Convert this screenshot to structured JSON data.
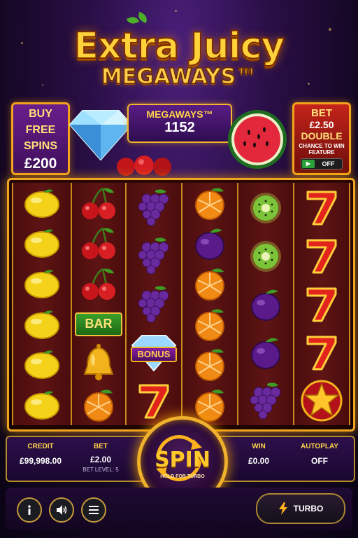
{
  "logo": {
    "title": "Extra Juicy",
    "subtitle": "MEGAWAYS™"
  },
  "buy_free_spins": {
    "line1": "BUY",
    "line2": "FREE",
    "line3": "SPINS",
    "price": "£200"
  },
  "megaways": {
    "label": "MEGAWAYS™",
    "count": "1152"
  },
  "bet_double": {
    "line1": "BET",
    "line2": "£2.50",
    "line3": "DOUBLE",
    "line4": "CHANCE TO WIN FEATURE",
    "toggle_state": "OFF"
  },
  "reels": [
    [
      "lemon",
      "lemon",
      "lemon",
      "lemon",
      "lemon",
      "lemon"
    ],
    [
      "cherries",
      "cherries",
      "cherries",
      "bar",
      "bell",
      "orange"
    ],
    [
      "grapes",
      "grapes",
      "grapes",
      "bonus",
      "seven"
    ],
    [
      "orange",
      "plum",
      "orange",
      "orange",
      "orange",
      "orange"
    ],
    [
      "kiwi",
      "kiwi",
      "plum",
      "plum",
      "grapes"
    ],
    [
      "seven",
      "seven",
      "seven",
      "seven",
      "star"
    ]
  ],
  "symbol_text": {
    "bar": "BAR",
    "bonus": "BONUS"
  },
  "credit": {
    "label": "CREDIT",
    "value": "£99,998.00"
  },
  "bet": {
    "label": "BET",
    "value": "£2.00",
    "sub": "BET LEVEL: 5"
  },
  "spin": {
    "label": "SPIN",
    "hold": "HOLD FOR TURBO"
  },
  "win": {
    "label": "WIN",
    "value": "£0.00"
  },
  "autoplay": {
    "label": "AUTOPLAY",
    "value": "OFF"
  },
  "turbo": {
    "label": "TURBO"
  },
  "colors": {
    "gold": "#f0b22c",
    "purple": "#2a0f47",
    "reel_red": "#4a0c0c"
  }
}
